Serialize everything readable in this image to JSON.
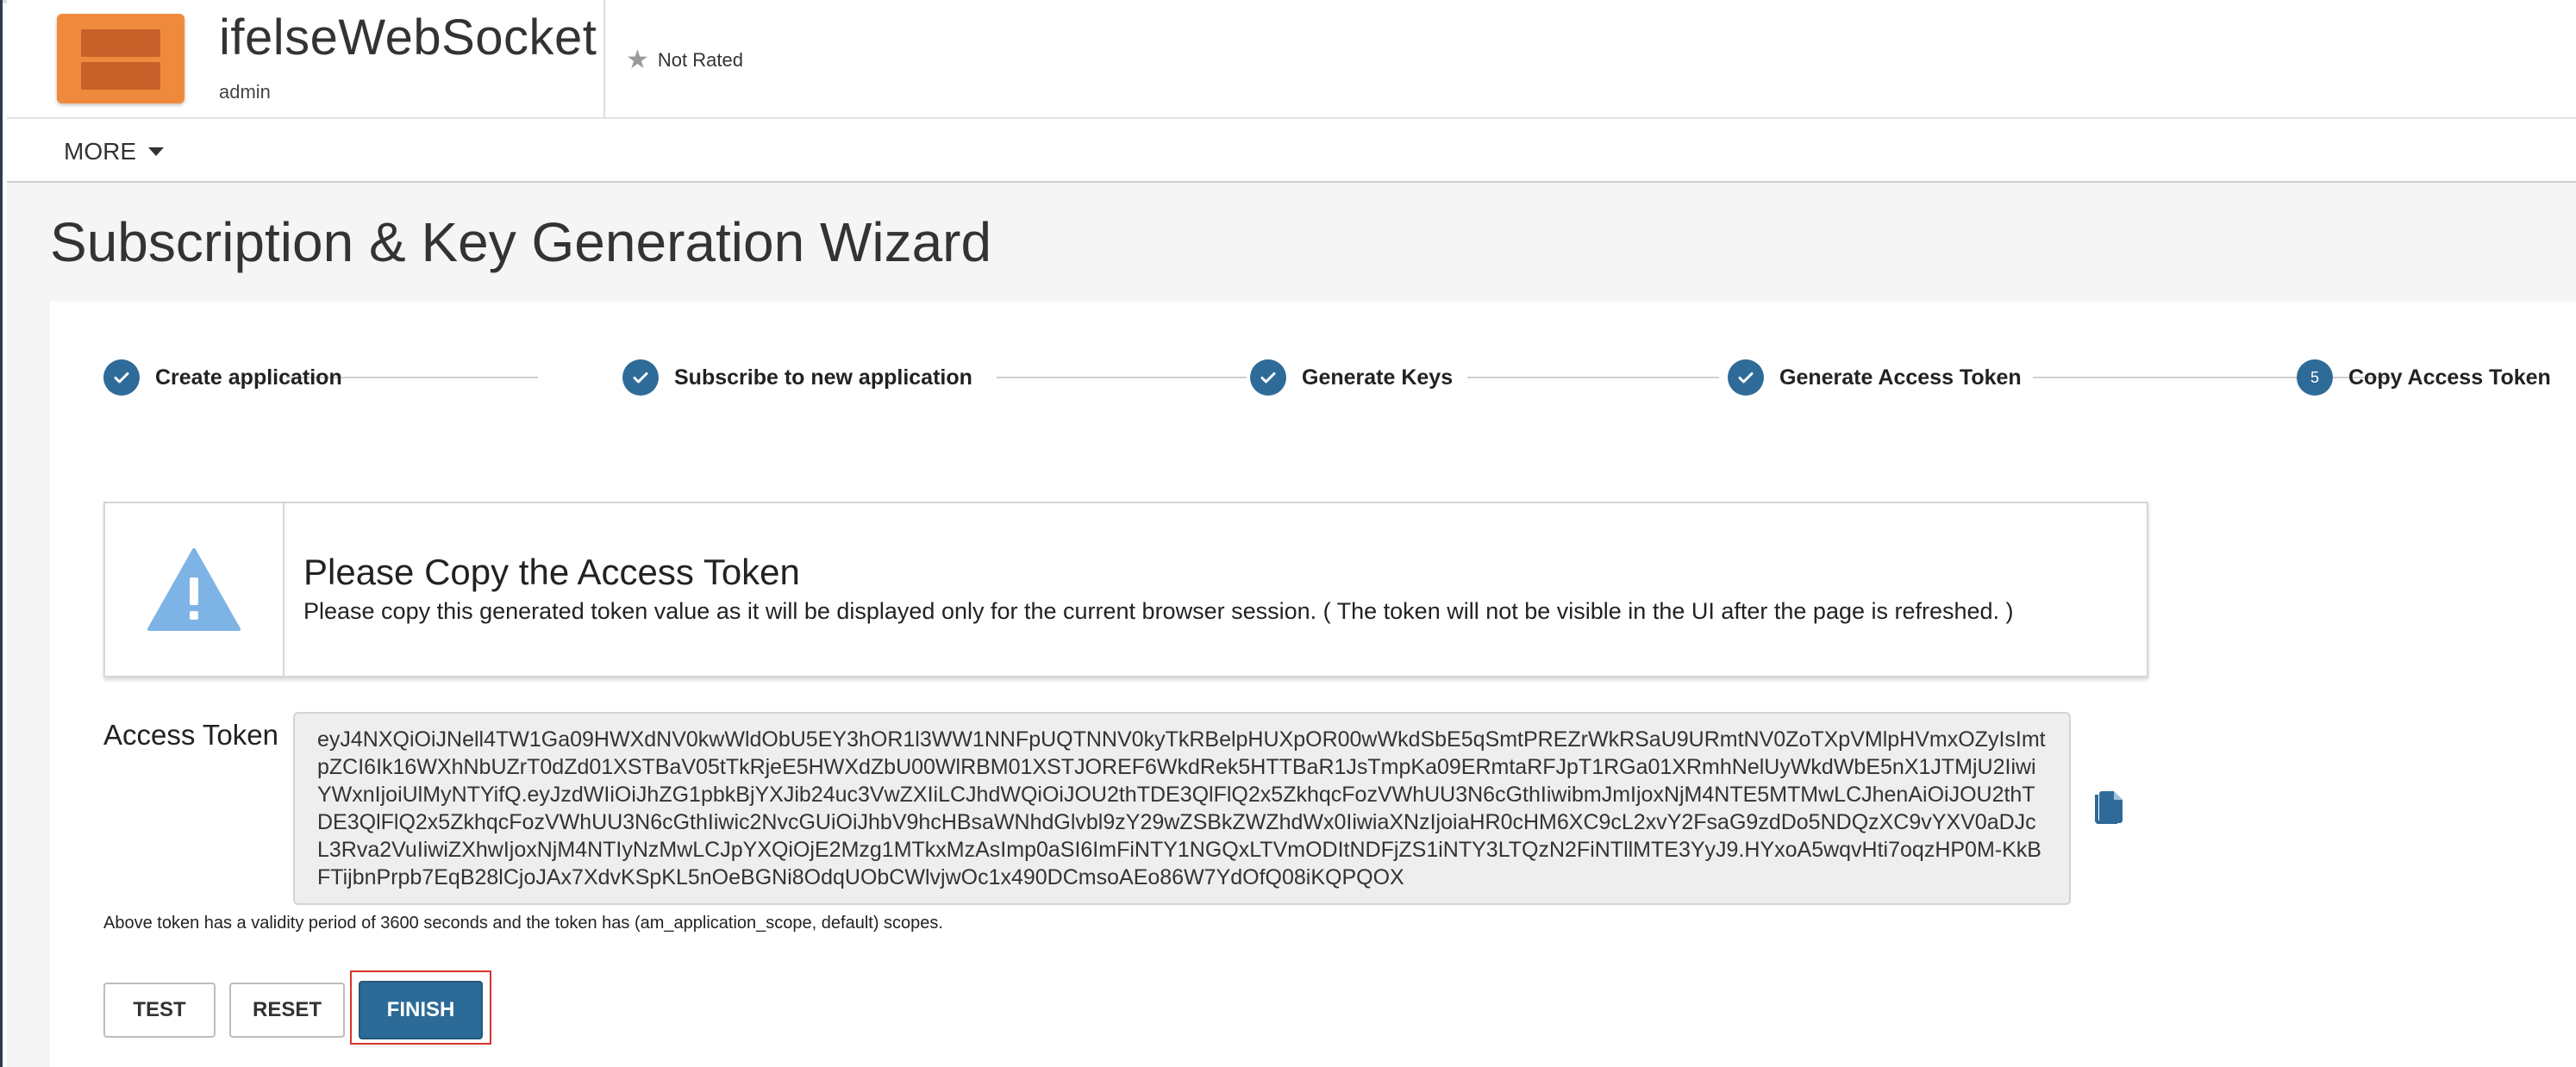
{
  "header": {
    "app_name": "ifelseWebSocket",
    "owner": "admin",
    "rating_label": "Not Rated",
    "rating_icon": "star-icon"
  },
  "nav": {
    "more_label": "MORE"
  },
  "page": {
    "title": "Subscription & Key Generation Wizard"
  },
  "wizard": {
    "steps": [
      {
        "label": "Create application",
        "state": "done"
      },
      {
        "label": "Subscribe to new application",
        "state": "done"
      },
      {
        "label": "Generate Keys",
        "state": "done"
      },
      {
        "label": "Generate Access Token",
        "state": "done"
      },
      {
        "label": "Copy Access Token",
        "state": "current",
        "number": "5"
      }
    ]
  },
  "alert": {
    "title": "Please Copy the Access Token",
    "message": "Please copy this generated token value as it will be displayed only for the current browser session. ( The token will not be visible in the UI after the page is refreshed. )",
    "icon": "warning-icon"
  },
  "token": {
    "label": "Access Token",
    "value": "eyJ4NXQiOiJNell4TW1Ga09HWXdNV0kwWldObU5EY3hOR1l3WW1NNFpUQTNNV0kyTkRBelpHUXpOR00wWkdSbE5qSmtPREZrWkRSaU9URmtNV0ZoTXpVMlpHVmxOZyIsImtpZCI6Ik16WXhNbUZrT0dZd01XSTBaV05tTkRjeE5HWXdZbU00WlRBM01XSTJOREF6WkdRek5HTTBaR1JsTmpKa09ERmtaRFJpT1RGa01XRmhNelUyWkdWbE5nX1JTMjU2IiwiYWxnIjoiUlMyNTYifQ.eyJzdWIiOiJhZG1pbkBjYXJib24uc3VwZXIiLCJhdWQiOiJOU2thTDE3QlFlQ2x5ZkhqcFozVWhUU3N6cGthIiwibmJmIjoxNjM4NTE5MTMwLCJhenAiOiJOU2thTDE3QlFlQ2x5ZkhqcFozVWhUU3N6cGthIiwic2NvcGUiOiJhbV9hcHBsaWNhdGlvbl9zY29wZSBkZWZhdWx0IiwiaXNzIjoiaHR0cHM6XC9cL2xvY2FsaG9zdDo5NDQzXC9vYXV0aDJcL3Rva2VuIiwiZXhwIjoxNjM4NTIyNzMwLCJpYXQiOjE2Mzg1MTkxMzAsImp0aSI6ImFiNTY1NGQxLTVmODItNDFjZS1iNTY3LTQzN2FiNTllMTE3YyJ9.HYxoA5wqvHti7oqzHP0M-KkBFTijbnPrpb7EqB28lCjoJAx7XdvKSpKL5nOeBGNi8OdqUObCWlvjwOc1x490DCmsoAEo86W7YdOfQ08iKQPQOX"
  },
  "validity_text": "Above token has a validity period of 3600 seconds and the token has (am_application_scope, default) scopes.",
  "buttons": {
    "test": "TEST",
    "reset": "RESET",
    "finish": "FINISH"
  },
  "colors": {
    "primary": "#2c6a97",
    "step_circle": "#2e6b98",
    "app_thumb": "#ef8a3c",
    "warning": "#7eb3e6",
    "highlight": "#d9342b"
  }
}
